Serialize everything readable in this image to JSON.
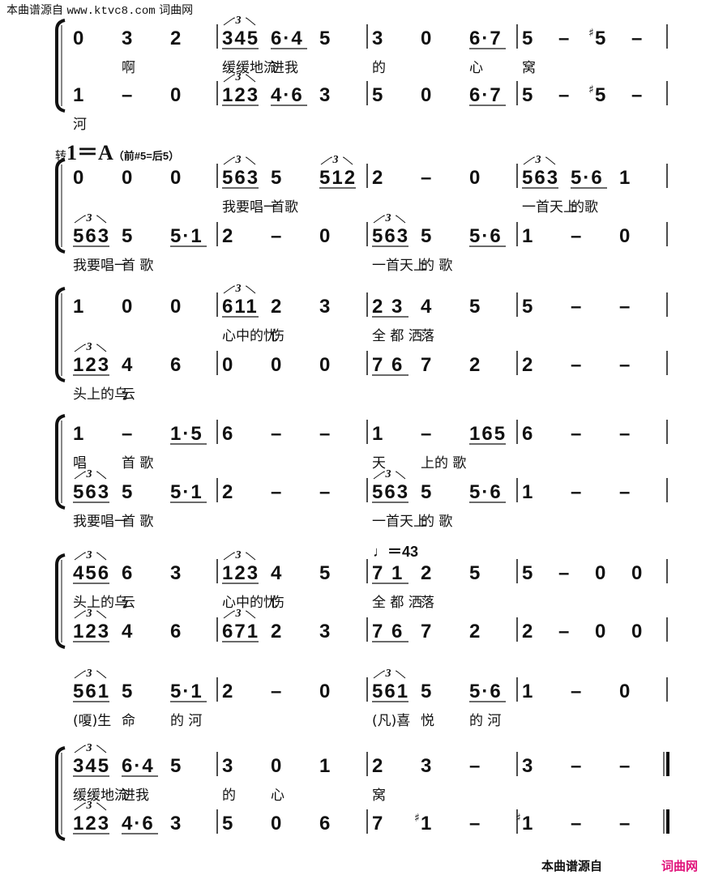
{
  "header": {
    "source_label": "本曲谱源自",
    "url": "www.ktvc8.com",
    "site_name": "词曲网"
  },
  "key_change": {
    "prefix": "转",
    "key": "1＝A",
    "note": "（前#5=后5）"
  },
  "tempo": {
    "symbol": "♩",
    "text": "＝43"
  },
  "footer": {
    "source_label": "本曲谱源自",
    "brand": "词曲网",
    "brand_color": "#e0137a"
  },
  "systems": [
    {
      "bracket": true,
      "staves": [
        {
          "measures": [
            {
              "notes": [
                "0",
                "3",
                "2"
              ],
              "lyrics": [
                "",
                "啊",
                ""
              ]
            },
            {
              "notes": [
                "(3)345",
                "6·4",
                "5"
              ],
              "lyrics": [
                "缓缓地流",
                "进我",
                ""
              ]
            },
            {
              "notes": [
                "3",
                "0",
                "6·7"
              ],
              "lyrics": [
                "的",
                "",
                "心"
              ]
            },
            {
              "notes": [
                "5",
                "–",
                "#5",
                "–"
              ],
              "lyrics": [
                "窝"
              ]
            }
          ]
        },
        {
          "measures": [
            {
              "notes": [
                "1",
                "–",
                "0"
              ],
              "lyrics": [
                "河"
              ]
            },
            {
              "notes": [
                "(3)123",
                "4·6",
                "3"
              ]
            },
            {
              "notes": [
                "5",
                "0",
                "6·7"
              ]
            },
            {
              "notes": [
                "5",
                "–",
                "#5",
                "–"
              ]
            }
          ]
        }
      ]
    },
    {
      "bracket": true,
      "staves": [
        {
          "measures": [
            {
              "notes": [
                "0",
                "0",
                "0"
              ]
            },
            {
              "notes": [
                "(3)563",
                "5",
                "(3)512"
              ],
              "lyrics": [
                "我要唱一",
                "首歌"
              ]
            },
            {
              "notes": [
                "2",
                "–",
                "0"
              ]
            },
            {
              "notes": [
                "(3)563",
                "5·6",
                "1"
              ],
              "lyrics": [
                "一首天上",
                "的歌"
              ]
            }
          ]
        },
        {
          "measures": [
            {
              "notes": [
                "(3)563",
                "5",
                "5·1"
              ],
              "lyrics": [
                "我要唱一",
                "首 歌"
              ]
            },
            {
              "notes": [
                "2",
                "–",
                "0"
              ]
            },
            {
              "notes": [
                "(3)563",
                "5",
                "5·6"
              ],
              "lyrics": [
                "一首天上",
                "的 歌"
              ]
            },
            {
              "notes": [
                "1",
                "–",
                "0"
              ]
            }
          ]
        }
      ]
    },
    {
      "bracket": true,
      "staves": [
        {
          "measures": [
            {
              "notes": [
                "1",
                "0",
                "0"
              ]
            },
            {
              "notes": [
                "(3)611",
                "2",
                "3"
              ],
              "lyrics": [
                "心中的忧",
                "伤"
              ]
            },
            {
              "notes": [
                "2 3",
                "4",
                "5"
              ],
              "lyrics": [
                "全 都 洒",
                "落"
              ]
            },
            {
              "notes": [
                "5",
                "–",
                "–"
              ]
            }
          ]
        },
        {
          "measures": [
            {
              "notes": [
                "(3)123",
                "4",
                "6"
              ],
              "lyrics": [
                "头上的乌",
                "云"
              ]
            },
            {
              "notes": [
                "0",
                "0",
                "0"
              ]
            },
            {
              "notes": [
                "7 6",
                "7",
                "2"
              ]
            },
            {
              "notes": [
                "2",
                "–",
                "–"
              ]
            }
          ]
        }
      ]
    },
    {
      "bracket": true,
      "staves": [
        {
          "measures": [
            {
              "notes": [
                "1",
                "–",
                "1·5"
              ],
              "lyrics": [
                "唱",
                "首 歌"
              ]
            },
            {
              "notes": [
                "6",
                "–",
                "–"
              ]
            },
            {
              "notes": [
                "1",
                "–",
                "165"
              ],
              "lyrics": [
                "天",
                "上的 歌"
              ]
            },
            {
              "notes": [
                "6",
                "–",
                "–"
              ]
            }
          ]
        },
        {
          "measures": [
            {
              "notes": [
                "(3)563",
                "5",
                "5·1"
              ],
              "lyrics": [
                "我要唱一",
                "首 歌"
              ]
            },
            {
              "notes": [
                "2",
                "–",
                "–"
              ]
            },
            {
              "notes": [
                "(3)563",
                "5",
                "5·6"
              ],
              "lyrics": [
                "一首天上",
                "的 歌"
              ]
            },
            {
              "notes": [
                "1",
                "–",
                "–"
              ]
            }
          ]
        }
      ]
    },
    {
      "bracket": true,
      "staves": [
        {
          "measures": [
            {
              "notes": [
                "(3)456",
                "6",
                "3"
              ],
              "lyrics": [
                "头上的乌",
                "云"
              ]
            },
            {
              "notes": [
                "(3)123",
                "4",
                "5"
              ],
              "lyrics": [
                "心中的忧",
                "伤"
              ]
            },
            {
              "notes": [
                "7 1",
                "2",
                "5"
              ],
              "lyrics": [
                "全 都 洒",
                "落"
              ]
            },
            {
              "notes": [
                "5",
                "–",
                "0",
                "0"
              ]
            }
          ]
        },
        {
          "measures": [
            {
              "notes": [
                "(3)123",
                "4",
                "6"
              ]
            },
            {
              "notes": [
                "(3)671",
                "2",
                "3"
              ]
            },
            {
              "notes": [
                "7 6",
                "7",
                "2"
              ]
            },
            {
              "notes": [
                "2",
                "–",
                "0",
                "0"
              ]
            }
          ]
        }
      ]
    },
    {
      "bracket": false,
      "staves": [
        {
          "measures": [
            {
              "notes": [
                "(3)561",
                "5",
                "5·1"
              ],
              "lyrics": [
                "(嗄)生",
                "命",
                "的 河"
              ]
            },
            {
              "notes": [
                "2",
                "–",
                "0"
              ]
            },
            {
              "notes": [
                "(3)561",
                "5",
                "5·6"
              ],
              "lyrics": [
                "(凡)喜",
                "悦",
                "的 河"
              ]
            },
            {
              "notes": [
                "1",
                "–",
                "0"
              ]
            }
          ]
        }
      ]
    },
    {
      "bracket": true,
      "staves": [
        {
          "measures": [
            {
              "notes": [
                "(3)345",
                "6·4",
                "5"
              ],
              "lyrics": [
                "缓缓地流",
                "进我"
              ]
            },
            {
              "notes": [
                "3",
                "0",
                "1"
              ],
              "lyrics": [
                "的",
                "心"
              ]
            },
            {
              "notes": [
                "2",
                "3",
                "–"
              ],
              "lyrics": [
                "窝"
              ]
            },
            {
              "notes": [
                "3",
                "–",
                "–"
              ]
            }
          ]
        },
        {
          "measures": [
            {
              "notes": [
                "(3)123",
                "4·6",
                "3"
              ]
            },
            {
              "notes": [
                "5",
                "0",
                "6"
              ]
            },
            {
              "notes": [
                "7",
                "#1",
                "–"
              ]
            },
            {
              "notes": [
                "#1",
                "–",
                "–"
              ]
            }
          ]
        }
      ]
    }
  ]
}
